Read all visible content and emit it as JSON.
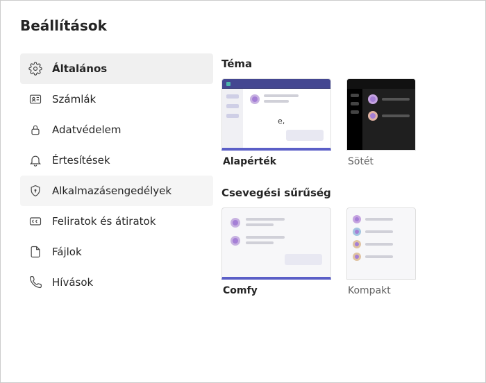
{
  "title": "Beállítások",
  "sidebar": {
    "items": [
      {
        "label": "Általános",
        "icon": "gear"
      },
      {
        "label": "Számlák",
        "icon": "id-card"
      },
      {
        "label": "Adatvédelem",
        "icon": "lock"
      },
      {
        "label": "Értesítések",
        "icon": "bell"
      },
      {
        "label": "Alkalmazásengedélyek",
        "icon": "shield"
      },
      {
        "label": "Feliratok és átiratok",
        "icon": "cc"
      },
      {
        "label": "Fájlok",
        "icon": "file"
      },
      {
        "label": "Hívások",
        "icon": "phone"
      }
    ]
  },
  "main": {
    "theme": {
      "title": "Téma",
      "options": [
        {
          "label": "Alapérték",
          "note": "e,"
        },
        {
          "label": "Sötét"
        }
      ]
    },
    "density": {
      "title": "Csevegési sűrűség",
      "options": [
        {
          "label": "Comfy"
        },
        {
          "label": "Kompakt"
        }
      ]
    }
  }
}
